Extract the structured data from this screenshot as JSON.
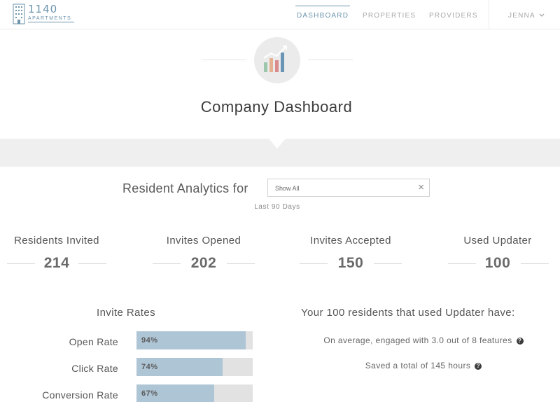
{
  "brand": {
    "name": "1140",
    "subtitle": "APARTMENTS",
    "color": "#6d95ad"
  },
  "nav": {
    "items": [
      {
        "label": "DASHBOARD",
        "active": true
      },
      {
        "label": "PROPERTIES",
        "active": false
      },
      {
        "label": "PROVIDERS",
        "active": false
      }
    ],
    "user": "JENNA",
    "user_icon": "chevron-down-icon"
  },
  "header": {
    "icon": "bar-chart-icon",
    "title": "Company Dashboard"
  },
  "filter": {
    "label": "Resident Analytics for",
    "value": "Show All",
    "clear_icon": "close-icon",
    "period": "Last 90 Days"
  },
  "stats": [
    {
      "label": "Residents Invited",
      "value": "214"
    },
    {
      "label": "Invites Opened",
      "value": "202"
    },
    {
      "label": "Invites Accepted",
      "value": "150"
    },
    {
      "label": "Used Updater",
      "value": "100"
    }
  ],
  "rates": {
    "title": "Invite Rates",
    "items": [
      {
        "label": "Open Rate",
        "percent_text": "94%",
        "value": 0.94
      },
      {
        "label": "Click Rate",
        "percent_text": "74%",
        "value": 0.74
      },
      {
        "label": "Conversion Rate",
        "percent_text": "67%",
        "value": 0.67
      }
    ],
    "fill_color": "#aec5d5",
    "track_color": "#e2e2e2"
  },
  "updater": {
    "title": "Your 100 residents that used Updater have:",
    "lines": [
      {
        "text": "On average, engaged with 3.0 out of 8 features",
        "icon": "help-icon"
      },
      {
        "text": "Saved a total of 145 hours",
        "icon": "help-icon"
      }
    ]
  }
}
